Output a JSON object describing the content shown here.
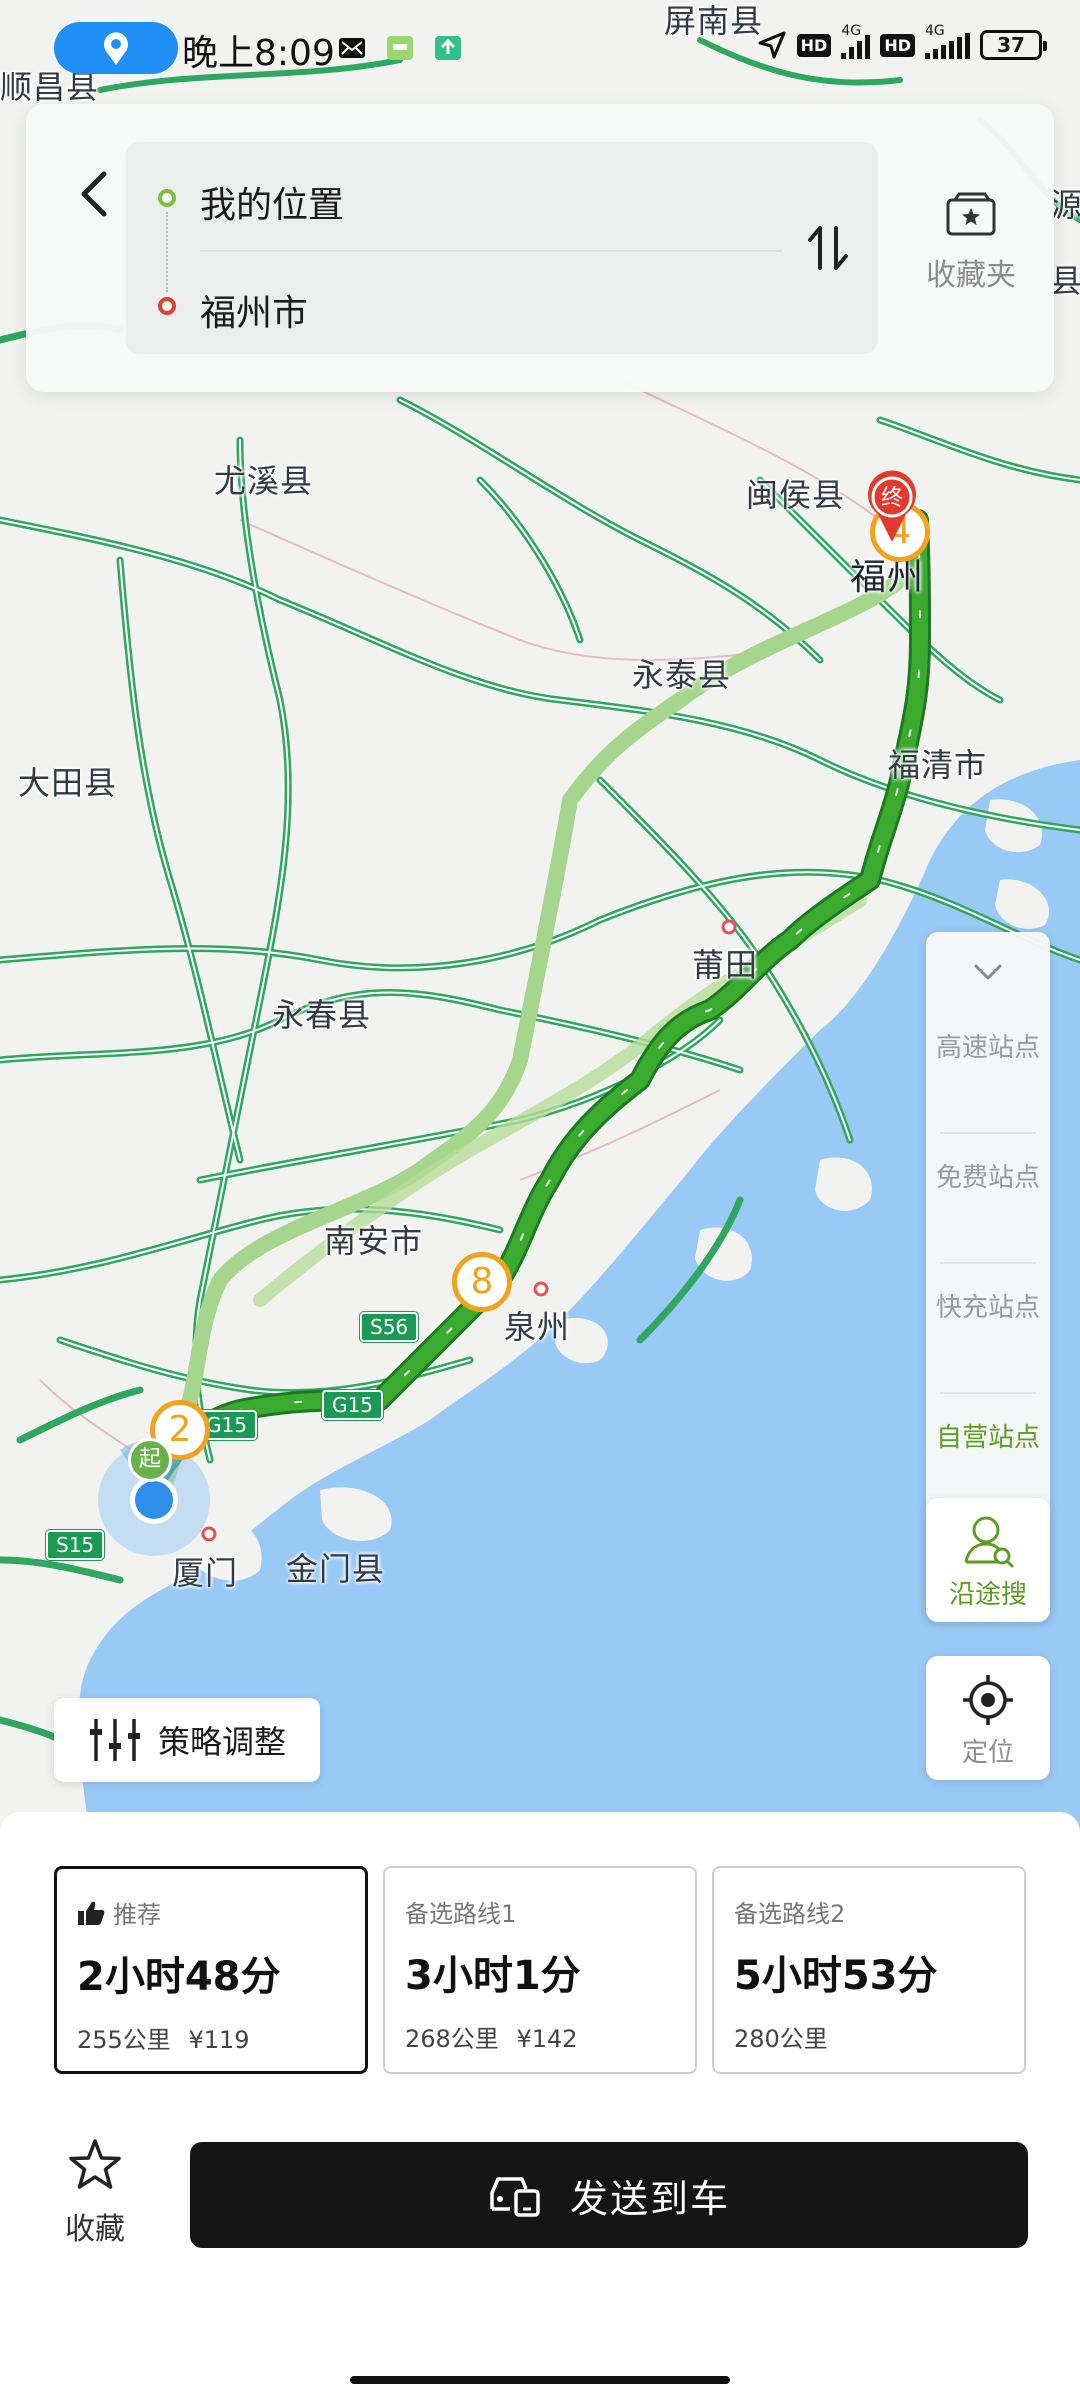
{
  "status_bar": {
    "time": "晚上8:09",
    "network_1": "4G",
    "network_2": "4G",
    "hd_1": "HD",
    "hd_2": "HD",
    "battery": "37"
  },
  "search": {
    "origin": "我的位置",
    "destination": "福州市",
    "favorites_label": "收藏夹"
  },
  "map": {
    "labels": {
      "shunchang": "顺昌县",
      "pingnan": "屏南县",
      "youxi": "尤溪县",
      "minhou": "闽侯县",
      "fuzhou": "福州",
      "yongtai": "永泰县",
      "datian": "大田县",
      "fuqing": "福清市",
      "putian": "莆田",
      "yongchun": "永春县",
      "nanan": "南安市",
      "quanzhou": "泉州",
      "xiamen": "厦门",
      "jinmen": "金门县",
      "edge_right_1": "源",
      "edge_right_2": "县"
    },
    "shields": {
      "s56": "S56",
      "g15": "G15",
      "g15_b": "G15",
      "s15": "S15"
    },
    "waypoints": {
      "a": "2",
      "b": "8",
      "c": "4"
    },
    "start_badge": "起",
    "end_badge": "终",
    "colors": {
      "route": "#3aab2f",
      "alt_route": "#b6dc9a",
      "sea": "#99c9f5",
      "highway": "#1a9a55"
    }
  },
  "side_panel": {
    "items": [
      {
        "label": "高速站点"
      },
      {
        "label": "免费站点"
      },
      {
        "label": "快充站点"
      },
      {
        "label": "自营站点"
      }
    ],
    "along_search": "沿途搜",
    "locate": "定位"
  },
  "strategy": {
    "label": "策略调整"
  },
  "routes": [
    {
      "tag": "推荐",
      "time": "2小时48分",
      "distance": "255公里",
      "fee": "¥119",
      "selected": true
    },
    {
      "tag": "备选路线1",
      "time": "3小时1分",
      "distance": "268公里",
      "fee": "¥142"
    },
    {
      "tag": "备选路线2",
      "time": "5小时53分",
      "distance": "280公里",
      "fee": ""
    }
  ],
  "actions": {
    "save": "收藏",
    "send_to_car": "发送到车"
  }
}
